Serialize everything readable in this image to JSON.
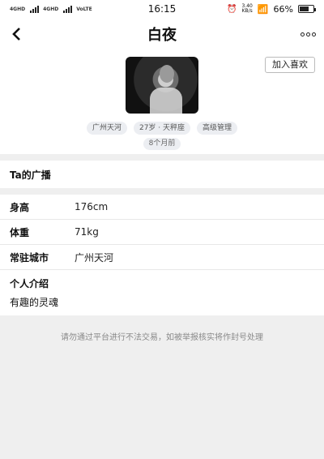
{
  "status": {
    "left_1": "4GHD",
    "left_2": "4GHD",
    "left_3": "VoLTE",
    "time": "16:15",
    "speed": "3.40",
    "speed_unit": "KB/s",
    "battery": "66%",
    "battery_level": 0.66
  },
  "nav": {
    "back_icon": "chevron-left-icon",
    "title": "白夜",
    "more_icon": "more-icon"
  },
  "profile": {
    "like_button": "加入喜欢",
    "tags": [
      "广州天河",
      "27岁 · 天秤座",
      "高级管理"
    ],
    "posted_ago": "8个月前"
  },
  "broadcast": {
    "label": "Ta的广播"
  },
  "details": [
    {
      "key": "身高",
      "value": "176cm"
    },
    {
      "key": "体重",
      "value": "71kg"
    },
    {
      "key": "常驻城市",
      "value": "广州天河"
    }
  ],
  "intro": {
    "key": "个人介绍",
    "value": "有趣的灵魂"
  },
  "notice": "请勿通过平台进行不法交易，如被举报核实将作封号处理"
}
